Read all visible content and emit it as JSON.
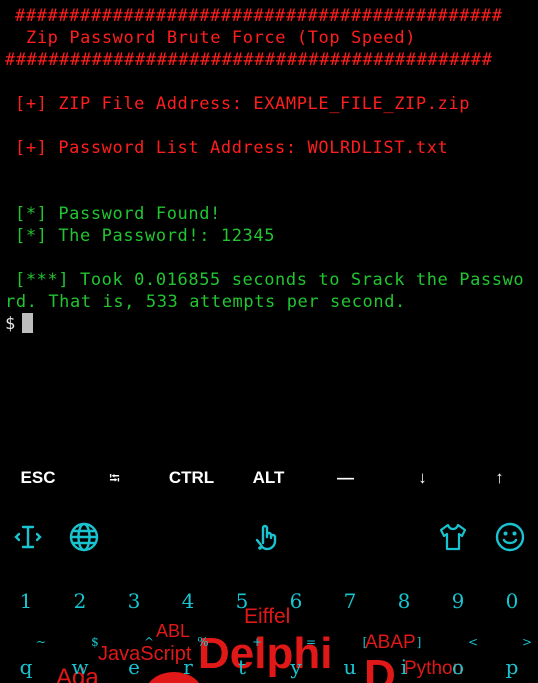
{
  "terminal": {
    "banner_top": "#############################################",
    "banner_title": "Zip Password Brute Force (Top Speed)",
    "banner_bottom": "#############################################",
    "zip_line": "[+] ZIP File Address: EXAMPLE_FILE_ZIP.zip",
    "list_line": "[+] Password List Address: WOLRDLIST.txt",
    "found_line": "[*] Password Found!",
    "password_line": "[*] The Password!: 12345",
    "took_line_1": "[***] Took 0.016855 seconds to Srack the Passwo",
    "took_line_2": "rd. That is, 533 attempts per second.",
    "prompt": "$"
  },
  "extra_keys": [
    "ESC",
    "⭾",
    "CTRL",
    "ALT",
    "—",
    "↓",
    "↑"
  ],
  "keyboard": {
    "toolbar_icons": [
      "text-cursor-icon",
      "globe-icon",
      "gesture-hand-icon",
      "theme-shirt-icon",
      "emoji-icon"
    ],
    "number_row": [
      "1",
      "2",
      "3",
      "4",
      "5",
      "6",
      "7",
      "8",
      "9",
      "0"
    ],
    "symbol_row": [
      "~",
      "$",
      "^",
      "%",
      "+",
      "=",
      "[",
      "]",
      "<",
      ">"
    ],
    "letter_row": [
      "q",
      "w",
      "e",
      "r",
      "t",
      "y",
      "u",
      "i",
      "o",
      "p"
    ],
    "wallpaper_words": [
      "Eiffel",
      "ABL",
      "JavaScript",
      "Delphi",
      "ABAP",
      "Python",
      "Ada",
      "D"
    ]
  },
  "colors": {
    "error_red": "#ff1e1e",
    "success_green": "#21c531",
    "key_cyan": "#18c4cf"
  }
}
